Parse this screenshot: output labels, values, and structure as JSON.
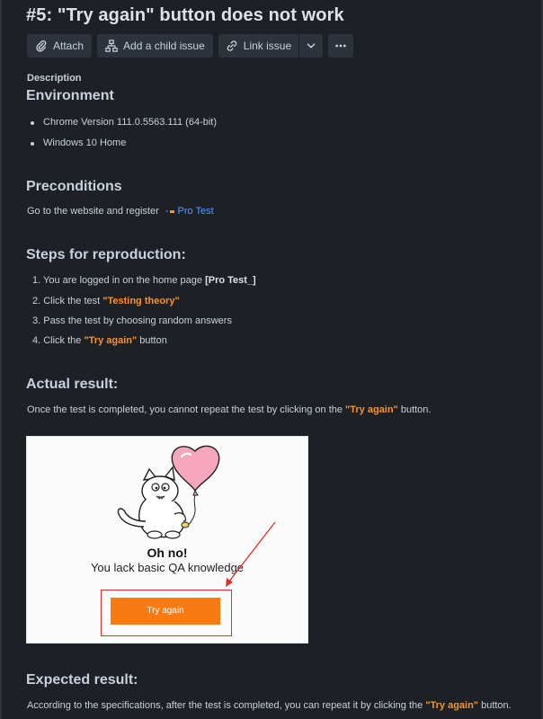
{
  "issue": {
    "title": "#5: \"Try again\" button does not work"
  },
  "toolbar": {
    "attach": "Attach",
    "add_child": "Add a child issue",
    "link_issue": "Link issue",
    "icons": [
      "paperclip-icon",
      "hierarchy-icon",
      "link-icon",
      "chevron-down-icon",
      "more-icon"
    ]
  },
  "description_label": "Description",
  "environment": {
    "heading": "Environment",
    "items": [
      "Chrome Version 111.0.5563.111 (64-bit)",
      "Windows 10 Home"
    ]
  },
  "preconditions": {
    "heading": "Preconditions",
    "text": "Go to the website and register",
    "link": "Pro Test"
  },
  "steps": {
    "heading": "Steps for reproduction:",
    "s1_pre": "1. You are logged in on the home page ",
    "s1_bold": "[Pro Test_]",
    "s2_pre": "2. Click the test ",
    "s2_hl": "\"Testing theory\"",
    "s3": "3. Pass the test by choosing random answers",
    "s4_pre": "4. Click the ",
    "s4_hl": "\"Try again\"",
    "s4_post": " button"
  },
  "actual": {
    "heading": "Actual result:",
    "pre": "Once the test is completed, you cannot repeat the test by clicking on the ",
    "hl": "\"Try again\"",
    "post": " button."
  },
  "screenshot": {
    "oh_no": "Oh no!",
    "lack": "You lack basic QA knowledge",
    "try_again": "Try again",
    "accent": "#fa7a12",
    "highlight": "#e02d2d"
  },
  "expected": {
    "heading": "Expected result:",
    "pre": "According to the specifications, after the test is completed, you can repeat it by clicking the ",
    "hl": "\"Try again\"",
    "post": " button."
  },
  "colors": {
    "background": "#1d2125",
    "text": "#c7d1db",
    "orange": "#f79232",
    "link": "#579dff"
  }
}
